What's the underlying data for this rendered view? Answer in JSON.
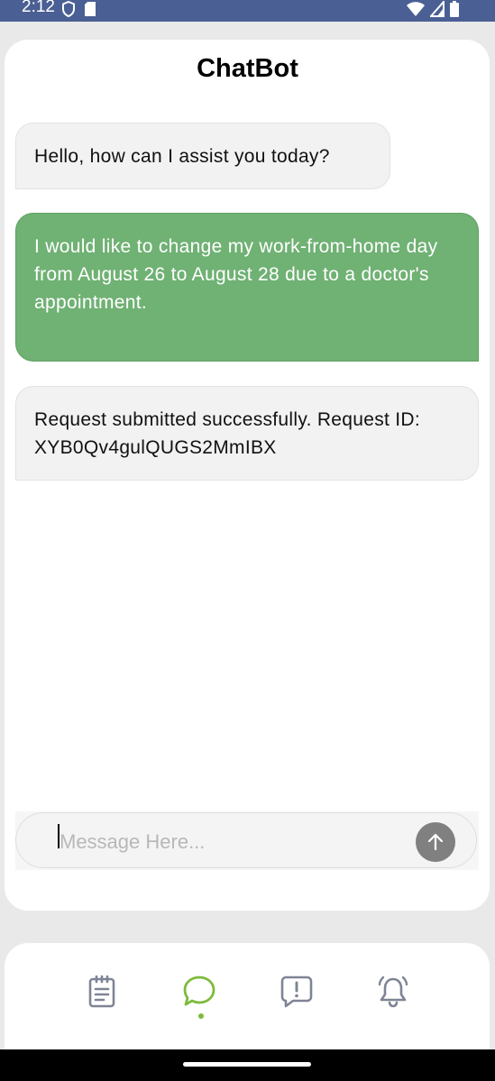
{
  "status_bar": {
    "time": "2:12"
  },
  "header": {
    "title": "ChatBot"
  },
  "messages": [
    {
      "sender": "bot",
      "text": "Hello, how can I assist you today?"
    },
    {
      "sender": "user",
      "text": "I would like to change my work-from-home day from August 26 to August 28 due to a doctor's appointment."
    },
    {
      "sender": "bot",
      "text": "Request submitted successfully. Request ID: XYB0Qv4gulQUGS2MmIBX"
    }
  ],
  "composer": {
    "placeholder": "Message Here...",
    "value": ""
  },
  "nav": {
    "items": [
      {
        "icon": "clipboard-icon",
        "active": false
      },
      {
        "icon": "chat-bubble-icon",
        "active": true
      },
      {
        "icon": "alert-message-icon",
        "active": false
      },
      {
        "icon": "bell-icon",
        "active": false
      }
    ]
  },
  "colors": {
    "user_bubble": "#70b174",
    "bot_bubble": "#f2f2f2",
    "accent": "#7dbb3b",
    "status_bar": "#4a5f93"
  }
}
